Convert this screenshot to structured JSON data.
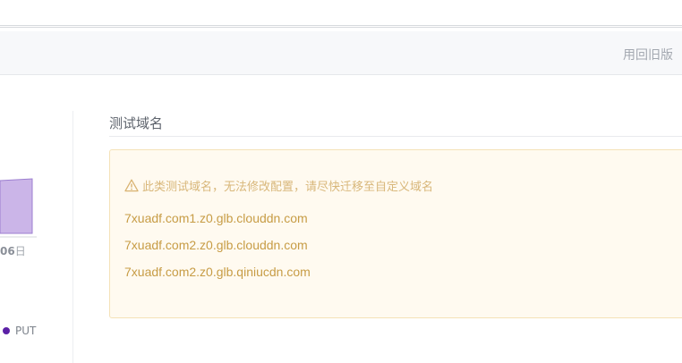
{
  "header": {
    "old_version_label": "用回旧版"
  },
  "chart": {
    "axis_label_number": "06",
    "axis_label_unit": "日",
    "legend": [
      {
        "label": "PUT",
        "color": "#5b20a6"
      }
    ],
    "fill_color": "#cbb5e8"
  },
  "test_domains": {
    "title": "测试域名",
    "warning": "此类测试域名，无法修改配置，请尽快迁移至自定义域名",
    "domains": [
      "7xuadf.com1.z0.glb.clouddn.com",
      "7xuadf.com2.z0.glb.clouddn.com",
      "7xuadf.com2.z0.glb.qiniucdn.com"
    ]
  }
}
